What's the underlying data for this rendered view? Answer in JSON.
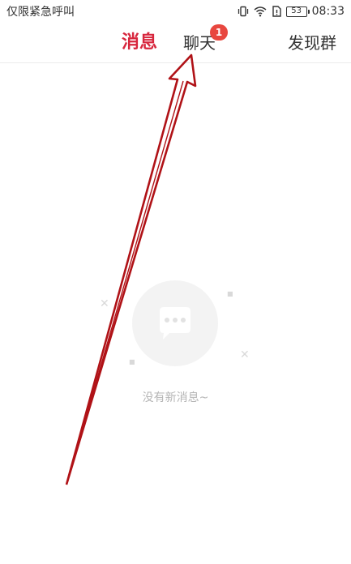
{
  "status_bar": {
    "carrier_text": "仅限紧急呼叫",
    "battery_level": "53",
    "time": "08:33",
    "icons": [
      "vibrate-icon",
      "wifi-icon",
      "sim-icon",
      "battery-icon"
    ]
  },
  "tabs": [
    {
      "label": "消息",
      "active": true
    },
    {
      "label": "聊天",
      "active": false,
      "badge": "1"
    },
    {
      "label": "发现群",
      "active": false
    }
  ],
  "empty_state": {
    "icon": "chat-bubble-icon",
    "text": "没有新消息~"
  },
  "annotation": {
    "icon": "pointer-arrow-icon",
    "color": "#b01217"
  },
  "colors": {
    "active_tab": "#d7263d",
    "badge": "#e8473f",
    "empty_text": "#b5b5b5",
    "circle": "#f3f3f3"
  }
}
